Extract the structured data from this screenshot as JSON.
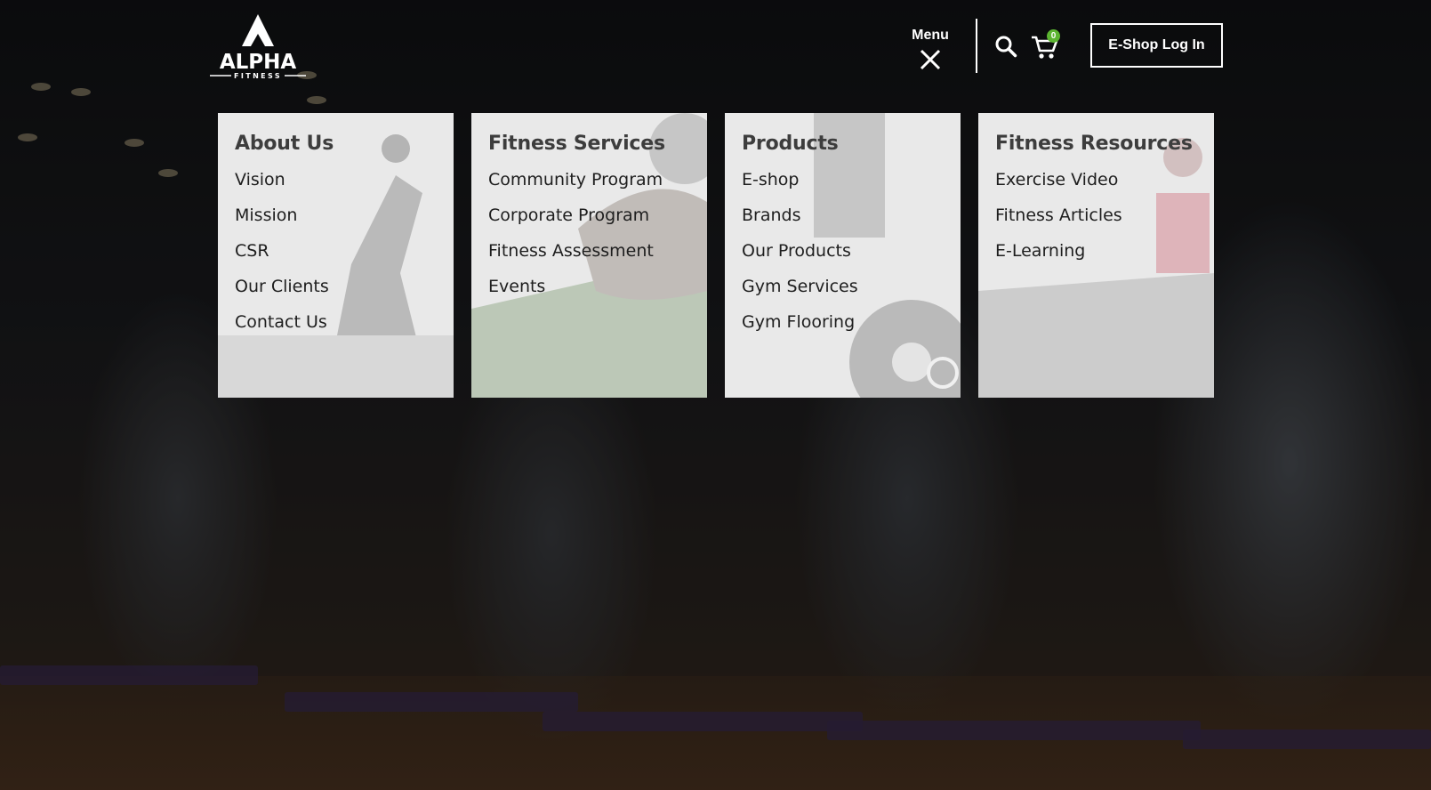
{
  "brand": {
    "logo_word": "ALPHA",
    "logo_tagline": "FITNESS"
  },
  "header": {
    "menu_label": "Menu",
    "cart_count": "0",
    "login_label": "E-Shop Log In",
    "icons": [
      "close-icon",
      "search-icon",
      "cart-icon"
    ],
    "badge_color": "#5cb531"
  },
  "menu": [
    {
      "title": "About Us",
      "items": [
        "Vision",
        "Mission",
        "CSR",
        "Our Clients",
        "Contact Us"
      ]
    },
    {
      "title": "Fitness Services",
      "items": [
        "Community Program",
        "Corporate Program",
        "Fitness Assessment",
        "Events"
      ]
    },
    {
      "title": "Products",
      "items": [
        "E-shop",
        "Brands",
        "Our Products",
        "Gym Services",
        "Gym Flooring"
      ]
    },
    {
      "title": "Fitness Resources",
      "items": [
        "Exercise Video",
        "Fitness Articles",
        "E-Learning"
      ]
    }
  ]
}
